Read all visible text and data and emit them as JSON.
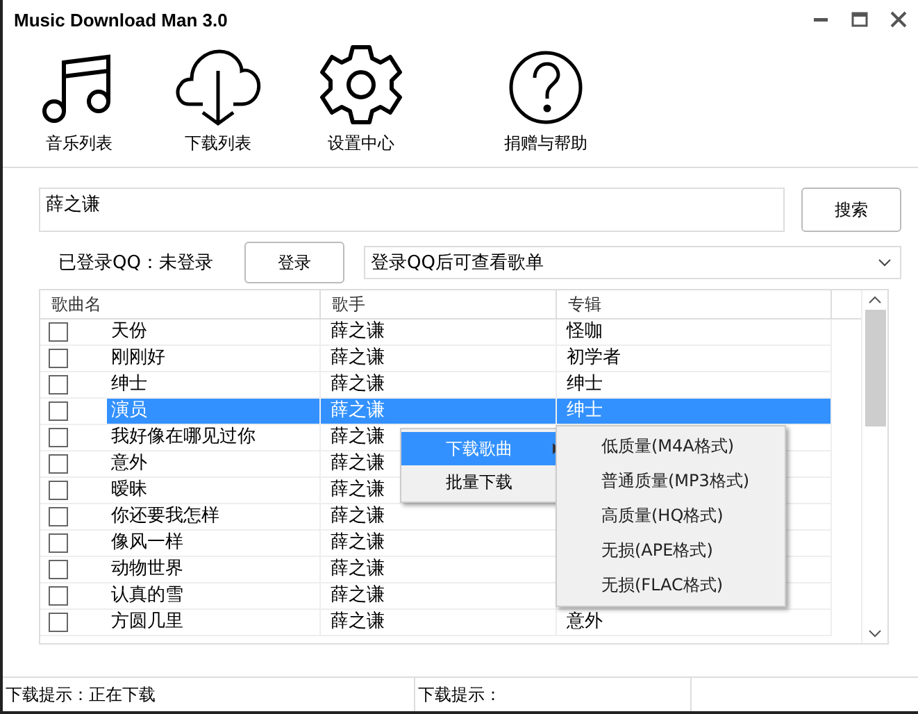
{
  "window": {
    "title": "Music Download Man 3.0"
  },
  "toolbar": [
    {
      "label": "音乐列表",
      "kind": "music"
    },
    {
      "label": "下载列表",
      "kind": "download"
    },
    {
      "label": "设置中心",
      "kind": "settings"
    },
    {
      "label": "捐赠与帮助",
      "kind": "help"
    }
  ],
  "search": {
    "value": "薛之谦",
    "button": "搜索"
  },
  "login": {
    "status": "已登录QQ：未登录",
    "button": "登录",
    "playlist": "登录QQ后可查看歌单"
  },
  "table": {
    "columns": [
      "歌曲名",
      "歌手",
      "专辑"
    ],
    "rows": [
      {
        "name": "天份",
        "singer": "薛之谦",
        "album": "怪咖",
        "checked": false,
        "selected": false
      },
      {
        "name": "刚刚好",
        "singer": "薛之谦",
        "album": "初学者",
        "checked": false,
        "selected": false
      },
      {
        "name": "绅士",
        "singer": "薛之谦",
        "album": "绅士",
        "checked": false,
        "selected": false
      },
      {
        "name": "演员",
        "singer": "薛之谦",
        "album": "绅士",
        "checked": false,
        "selected": true
      },
      {
        "name": "我好像在哪见过你",
        "singer": "薛之谦",
        "checked": false,
        "selected": false
      },
      {
        "name": "意外",
        "singer": "薛之谦",
        "checked": false,
        "selected": false
      },
      {
        "name": "暧昧",
        "singer": "薛之谦",
        "checked": false,
        "selected": false
      },
      {
        "name": "你还要我怎样",
        "singer": "薛之谦",
        "checked": false,
        "selected": false
      },
      {
        "name": "像风一样",
        "singer": "薛之谦",
        "checked": false,
        "selected": false
      },
      {
        "name": "动物世界",
        "singer": "薛之谦",
        "checked": false,
        "selected": false
      },
      {
        "name": "认真的雪",
        "singer": "薛之谦",
        "checked": false,
        "selected": false
      },
      {
        "name": "方圆几里",
        "singer": "薛之谦",
        "album": "意外",
        "checked": false,
        "selected": false
      }
    ]
  },
  "context_menu": {
    "items": [
      {
        "label": "下载歌曲",
        "selected": true,
        "submenu": true
      },
      {
        "label": "批量下载",
        "selected": false,
        "submenu": false
      }
    ],
    "submenu": [
      "低质量(M4A格式)",
      "普通质量(MP3格式)",
      "高质量(HQ格式)",
      "无损(APE格式)",
      "无损(FLAC格式)"
    ]
  },
  "status_bar": [
    "下载提示：正在下载",
    "下载提示："
  ]
}
